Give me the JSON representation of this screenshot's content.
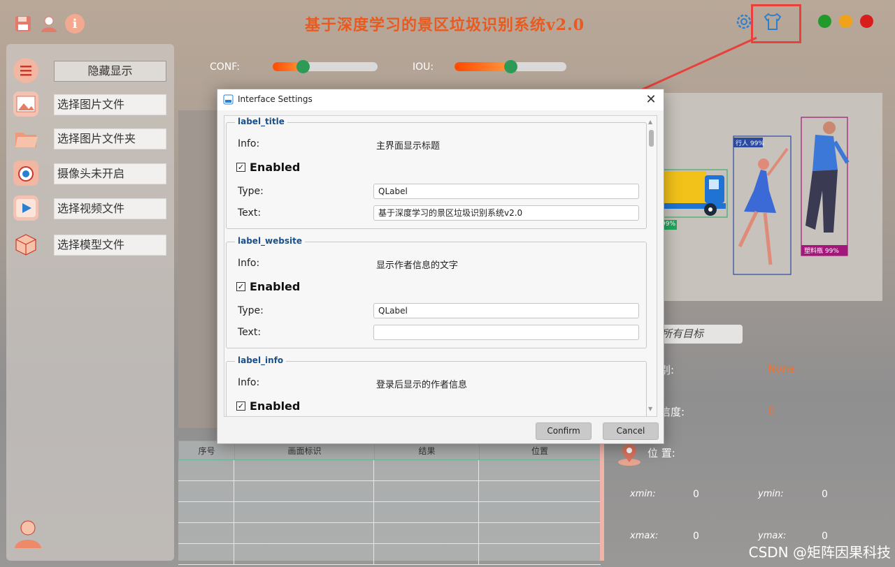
{
  "app": {
    "title": "基于深度学习的景区垃圾识别系统v2.0",
    "colors": {
      "title": "#e85a1f",
      "accent_green": "#2e9a57",
      "slider_orange": "#ff6a10",
      "highlight_red": "#e8413c"
    }
  },
  "toolbar_icons": [
    "save-icon",
    "user-icon",
    "info-icon",
    "settings-gear-icon",
    "tshirt-theme-icon"
  ],
  "window_controls": [
    "green",
    "orange",
    "red"
  ],
  "sidebar": {
    "items": [
      {
        "icon": "menu-list-icon",
        "label": "隐藏显示"
      },
      {
        "icon": "image-file-icon",
        "label": "选择图片文件"
      },
      {
        "icon": "folder-icon",
        "label": "选择图片文件夹"
      },
      {
        "icon": "camera-icon",
        "label": "摄像头未开启"
      },
      {
        "icon": "video-play-icon",
        "label": "选择视频文件"
      },
      {
        "icon": "model-cube-icon",
        "label": "选择模型文件"
      }
    ]
  },
  "sliders": {
    "conf": {
      "label": "CONF:",
      "value": 0.25
    },
    "iou": {
      "label": "IOU:",
      "value": 0.5
    }
  },
  "detections": {
    "person_label": "行人 99%",
    "other_label": "塑料瓶 99%",
    "truck_label": "99%"
  },
  "table": {
    "headers": [
      "序号",
      "画面标识",
      "结果",
      "位置"
    ]
  },
  "info_panel": {
    "target_select": "所有目标",
    "category_label": "别:",
    "category_value": "None",
    "confidence_label": "信度:",
    "confidence_value": "0",
    "position_label": "位 置:",
    "xmin_label": "xmin:",
    "xmin_value": "0",
    "ymin_label": "ymin:",
    "ymin_value": "0",
    "xmax_label": "xmax:",
    "xmax_value": "0",
    "ymax_label": "ymax:",
    "ymax_value": "0"
  },
  "dialog": {
    "title": "Interface Settings",
    "info_label": "Info:",
    "enabled_label": "Enabled",
    "type_label": "Type:",
    "text_label": "Text:",
    "groups": [
      {
        "name": "label_title",
        "info": "主界面显示标题",
        "enabled": true,
        "type": "QLabel",
        "text": "基于深度学习的景区垃圾识别系统v2.0"
      },
      {
        "name": "label_website",
        "info": "显示作者信息的文字",
        "enabled": true,
        "type": "QLabel",
        "text": ""
      },
      {
        "name": "label_info",
        "info": "登录后显示的作者信息",
        "enabled": true
      }
    ],
    "confirm_label": "Confirm",
    "cancel_label": "Cancel"
  },
  "watermark": "CSDN @矩阵因果科技"
}
